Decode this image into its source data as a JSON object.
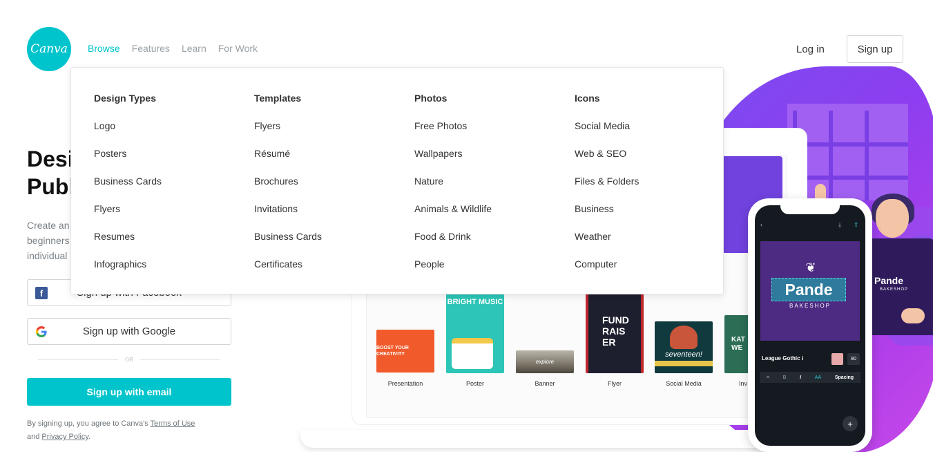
{
  "header": {
    "logo_text": "Canva",
    "nav": [
      {
        "label": "Browse",
        "active": true
      },
      {
        "label": "Features",
        "active": false
      },
      {
        "label": "Learn",
        "active": false
      },
      {
        "label": "For Work",
        "active": false
      }
    ],
    "login_label": "Log in",
    "signup_label": "Sign up"
  },
  "hero": {
    "title_line1": "Desi",
    "title_line2": "Publ",
    "desc_line1": "Create an",
    "desc_line2": "beginners",
    "desc_line3": "individual",
    "facebook_label": "Sign up with Facebook",
    "google_label": "Sign up with Google",
    "or_label": "OR",
    "email_label": "Sign up with email",
    "terms_prefix": "By signing up, you agree to Canva's ",
    "terms_link": "Terms of Use",
    "terms_and": "and ",
    "privacy_link": "Privacy Policy",
    "terms_suffix": "."
  },
  "menu": {
    "columns": [
      {
        "heading": "Design Types",
        "items": [
          "Logo",
          "Posters",
          "Business Cards",
          "Flyers",
          "Resumes",
          "Infographics"
        ]
      },
      {
        "heading": "Templates",
        "items": [
          "Flyers",
          "Résumé",
          "Brochures",
          "Invitations",
          "Business Cards",
          "Certificates"
        ]
      },
      {
        "heading": "Photos",
        "items": [
          "Free Photos",
          "Wallpapers",
          "Nature",
          "Animals & Wildlife",
          "Food & Drink",
          "People"
        ]
      },
      {
        "heading": "Icons",
        "items": [
          "Social Media",
          "Web & SEO",
          "Files & Folders",
          "Business",
          "Weather",
          "Computer"
        ]
      }
    ]
  },
  "showcase": {
    "thumbs": [
      {
        "label": "Presentation",
        "text": "BOOST YOUR CREATIVITY"
      },
      {
        "label": "Poster",
        "text": "BRIGHT MUSIC"
      },
      {
        "label": "Banner",
        "text": "explore"
      },
      {
        "label": "Flyer",
        "text": "FUND RAIS ER"
      },
      {
        "label": "Social Media",
        "text": "seventeen!"
      },
      {
        "label": "Inv",
        "text": "KAT WE"
      }
    ]
  },
  "phone": {
    "brand": "Pande",
    "sub": "BAKESHOP",
    "font_name": "League Gothic",
    "font_size": "80",
    "toolbar": [
      "B",
      "I",
      "AA",
      "Spacing"
    ],
    "add_symbol": "+"
  },
  "apron": {
    "brand": "Pande",
    "sub": "BAKESHOP"
  },
  "colors": {
    "brand": "#00c4cc",
    "accent_purple": "#8d3ef0"
  }
}
